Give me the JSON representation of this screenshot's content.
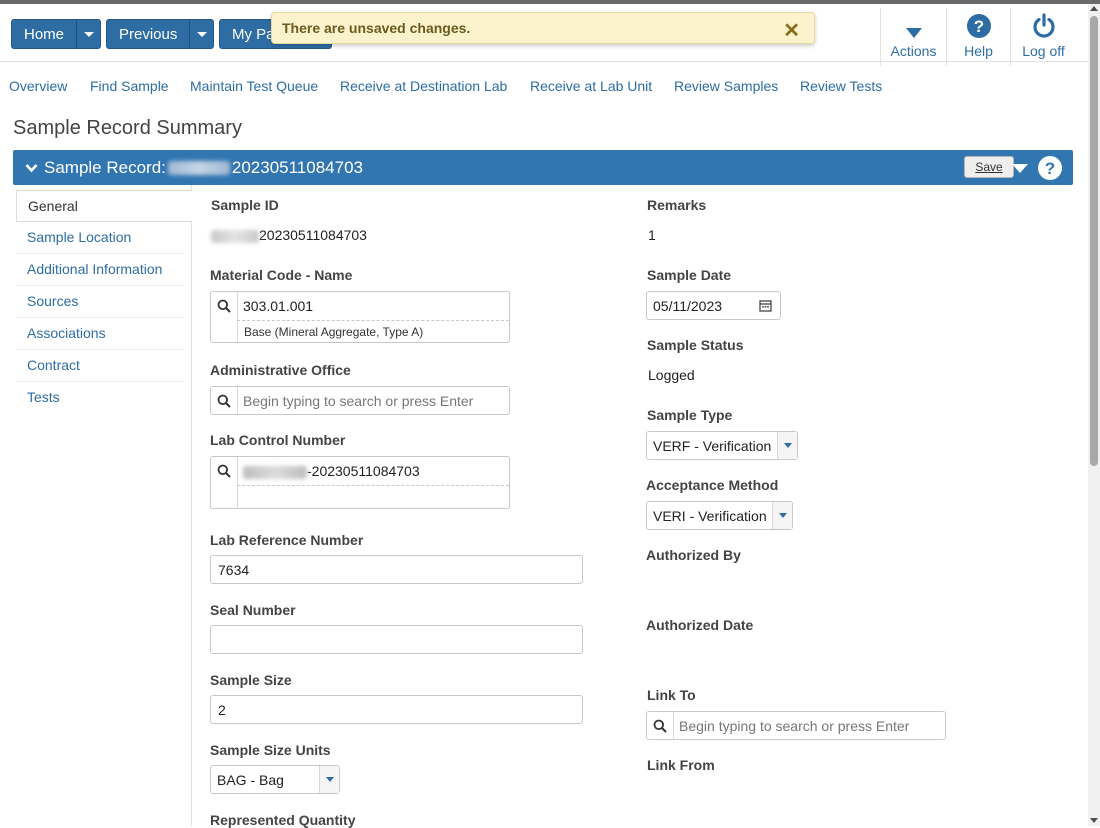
{
  "topnav": {
    "home_label": "Home",
    "previous_label": "Previous",
    "my_page_label": "My Pa",
    "actions_label": "Actions",
    "help_label": "Help",
    "logoff_label": "Log off"
  },
  "toast": {
    "message": "There are unsaved changes.",
    "close_symbol": "✕"
  },
  "tabs": [
    "Overview",
    "Find Sample",
    "Maintain Test Queue",
    "Receive at Destination Lab",
    "Receive at Lab Unit",
    "Review Samples",
    "Review Tests"
  ],
  "page": {
    "title": "Sample Record Summary"
  },
  "panel": {
    "title_prefix": "Sample Record:",
    "title_suffix": "20230511084703",
    "save_label": "Save"
  },
  "sidebar": {
    "items": [
      "General",
      "Sample Location",
      "Additional Information",
      "Sources",
      "Associations",
      "Contract",
      "Tests"
    ]
  },
  "form": {
    "sample_id": {
      "label": "Sample ID",
      "value_suffix": "20230511084703"
    },
    "material_code": {
      "label": "Material Code - Name",
      "value": "303.01.001",
      "description": "Base (Mineral Aggregate, Type A)"
    },
    "admin_office": {
      "label": "Administrative Office",
      "placeholder": "Begin typing to search or press Enter"
    },
    "lab_control_number": {
      "label": "Lab Control Number",
      "value_suffix": "-20230511084703"
    },
    "lab_reference_number": {
      "label": "Lab Reference Number",
      "value": "7634"
    },
    "seal_number": {
      "label": "Seal Number",
      "value": ""
    },
    "sample_size": {
      "label": "Sample Size",
      "value": "2"
    },
    "sample_size_units": {
      "label": "Sample Size Units",
      "value": "BAG - Bag"
    },
    "represented_quantity": {
      "label": "Represented Quantity"
    },
    "remarks": {
      "label": "Remarks",
      "value": "1"
    },
    "sample_date": {
      "label": "Sample Date",
      "value": "05/11/2023"
    },
    "sample_status": {
      "label": "Sample Status",
      "value": "Logged"
    },
    "sample_type": {
      "label": "Sample Type",
      "value": "VERF - Verification"
    },
    "acceptance_method": {
      "label": "Acceptance Method",
      "value": "VERI - Verification"
    },
    "authorized_by": {
      "label": "Authorized By"
    },
    "authorized_date": {
      "label": "Authorized Date"
    },
    "link_to": {
      "label": "Link To",
      "placeholder": "Begin typing to search or press Enter"
    },
    "link_from": {
      "label": "Link From"
    }
  },
  "icons": {
    "actions": "caret-down-icon",
    "help": "question-circle-icon",
    "logoff": "power-icon",
    "search": "magnifier-icon",
    "calendar": "calendar-icon"
  },
  "colors": {
    "brand_blue": "#2e6da4",
    "panel_blue": "#3276b1",
    "toast_bg": "#fcf3cd",
    "link_blue": "#2e6da4"
  }
}
